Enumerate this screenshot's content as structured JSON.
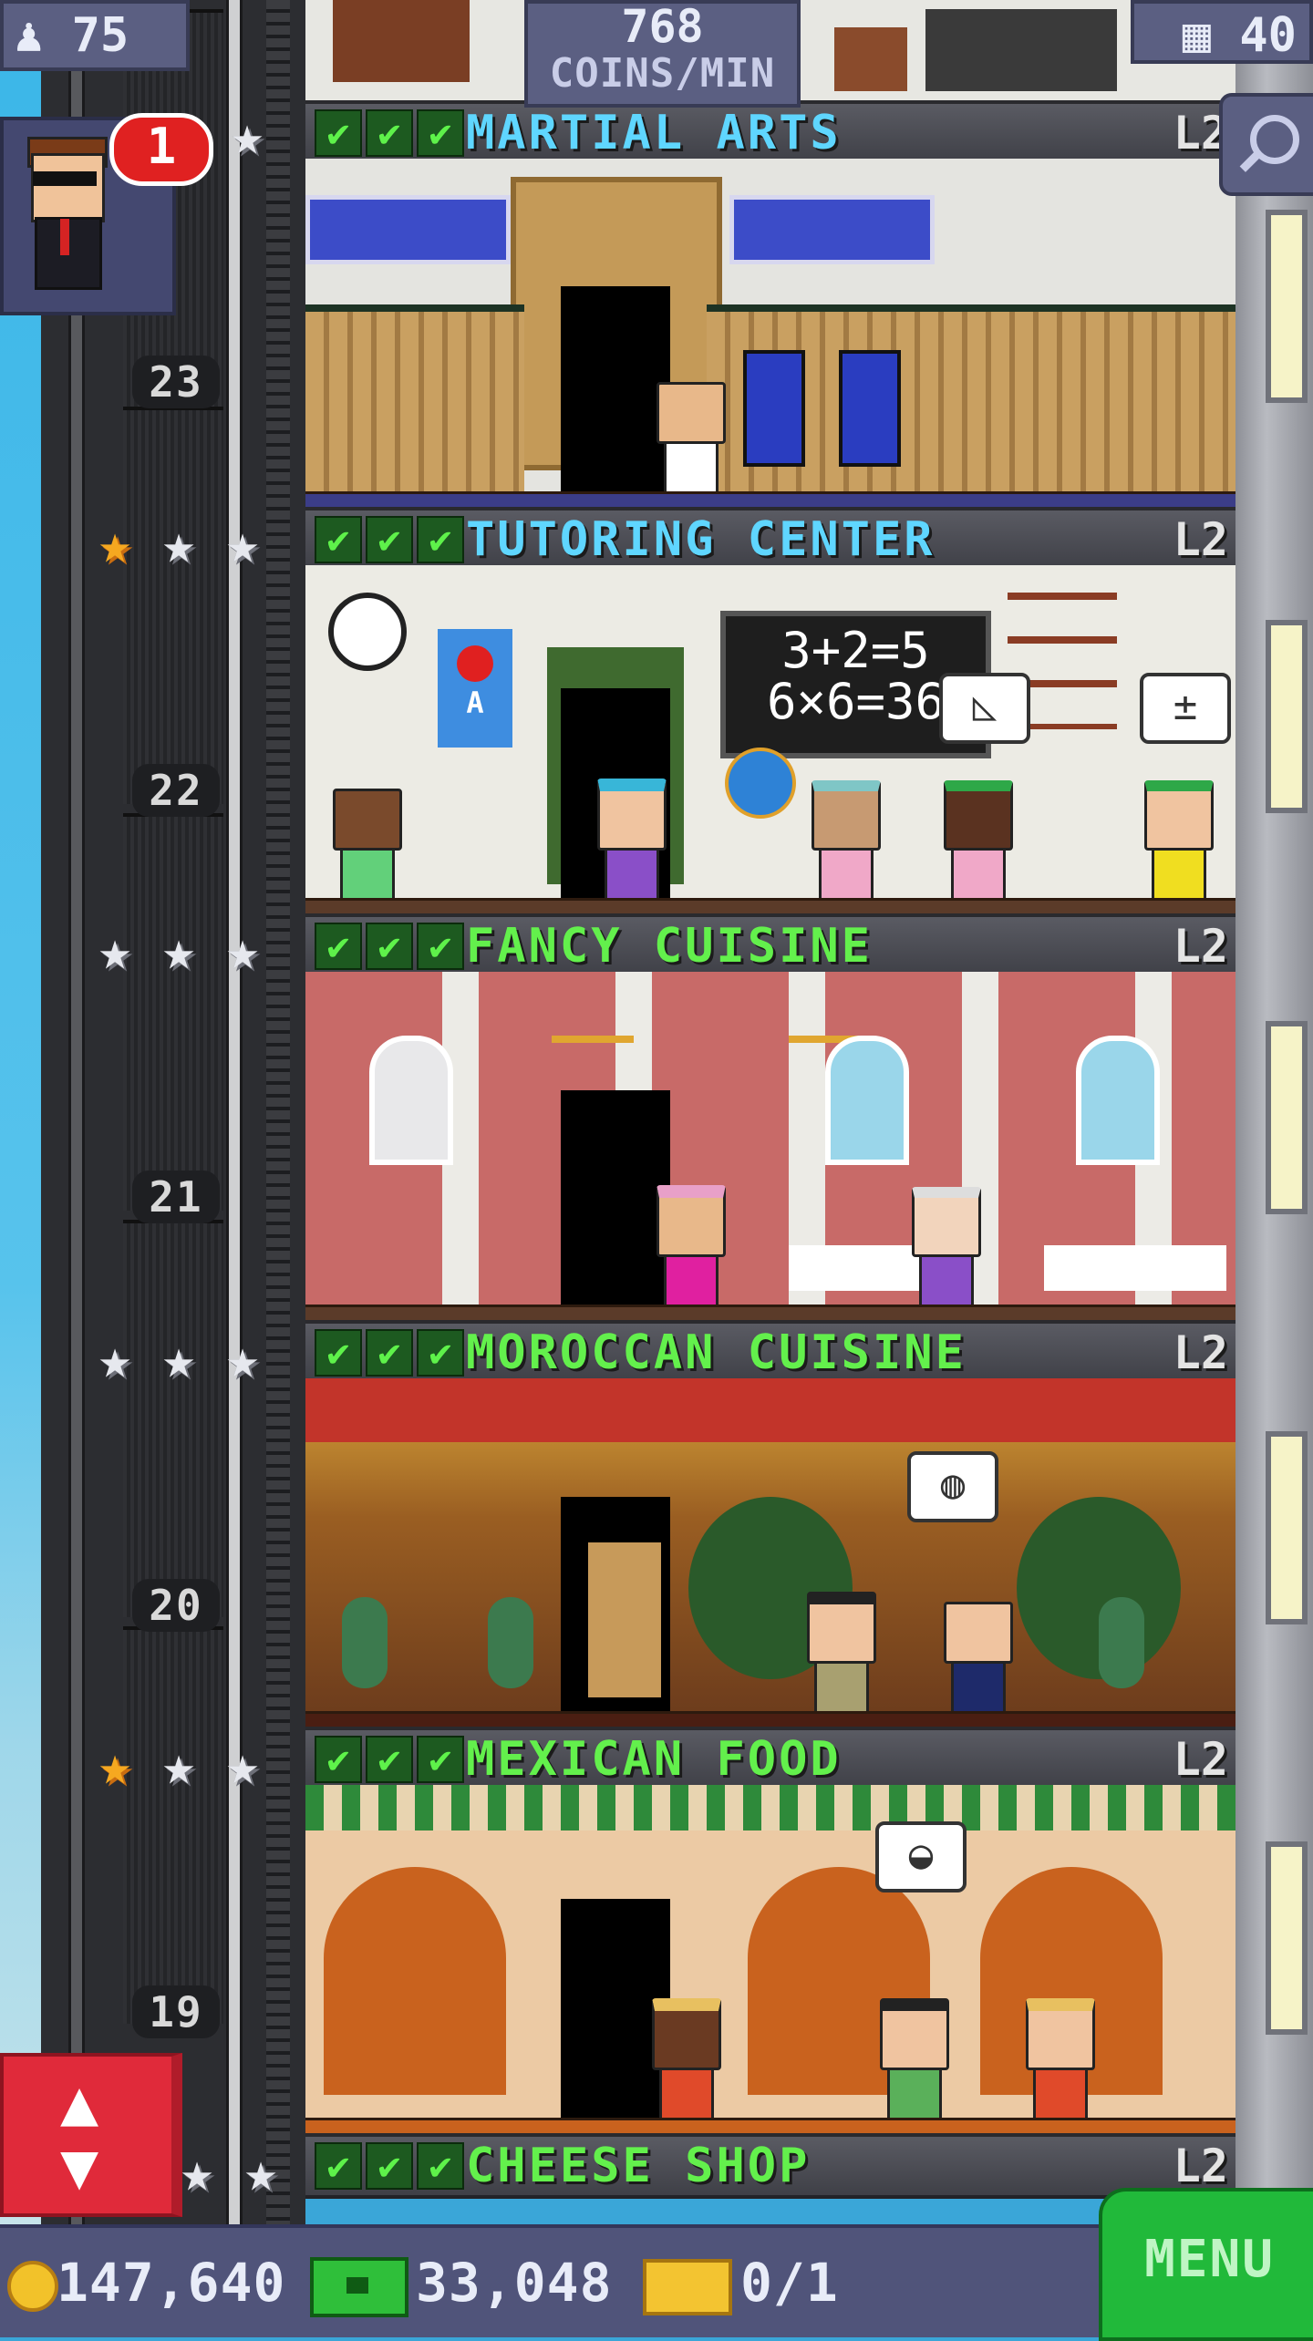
{
  "hud": {
    "population": "75",
    "coins_per_min_value": "768",
    "coins_per_min_label": "COINS/MIN",
    "floor_count": "40",
    "vip_notification_count": "1"
  },
  "floors": [
    {
      "name": "MARTIAL ARTS",
      "level": "L2",
      "number": "23",
      "gold_stars": 0
    },
    {
      "name": "TUTORING CENTER",
      "level": "L2",
      "number": "22",
      "gold_stars": 1
    },
    {
      "name": "FANCY CUISINE",
      "level": "L2",
      "number": "21",
      "gold_stars": 0
    },
    {
      "name": "MOROCCAN CUISINE",
      "level": "L2",
      "number": "20",
      "gold_stars": 0
    },
    {
      "name": "MEXICAN FOOD",
      "level": "L2",
      "number": "19",
      "gold_stars": 1
    },
    {
      "name": "CHEESE SHOP",
      "level": "L2"
    }
  ],
  "room_text": {
    "chalkboard_line1": "3+2=5",
    "chalkboard_line2": "6×6=36",
    "poster_letter": "A"
  },
  "bottom_bar": {
    "coins": "147,640",
    "bux": "33,048",
    "tickets": "0/1",
    "menu_label": "MENU"
  },
  "colors": {
    "floor_name_blue": "#5fd6ff",
    "floor_name_green": "#63f04c",
    "menu_green": "#21b93a",
    "elevator_red": "#e02a3a"
  },
  "icons": [
    "population-icon",
    "floors-icon",
    "search-icon",
    "star-icon",
    "check-icon",
    "coin-icon",
    "bux-icon",
    "ticket-icon",
    "elevator-arrows-icon"
  ]
}
